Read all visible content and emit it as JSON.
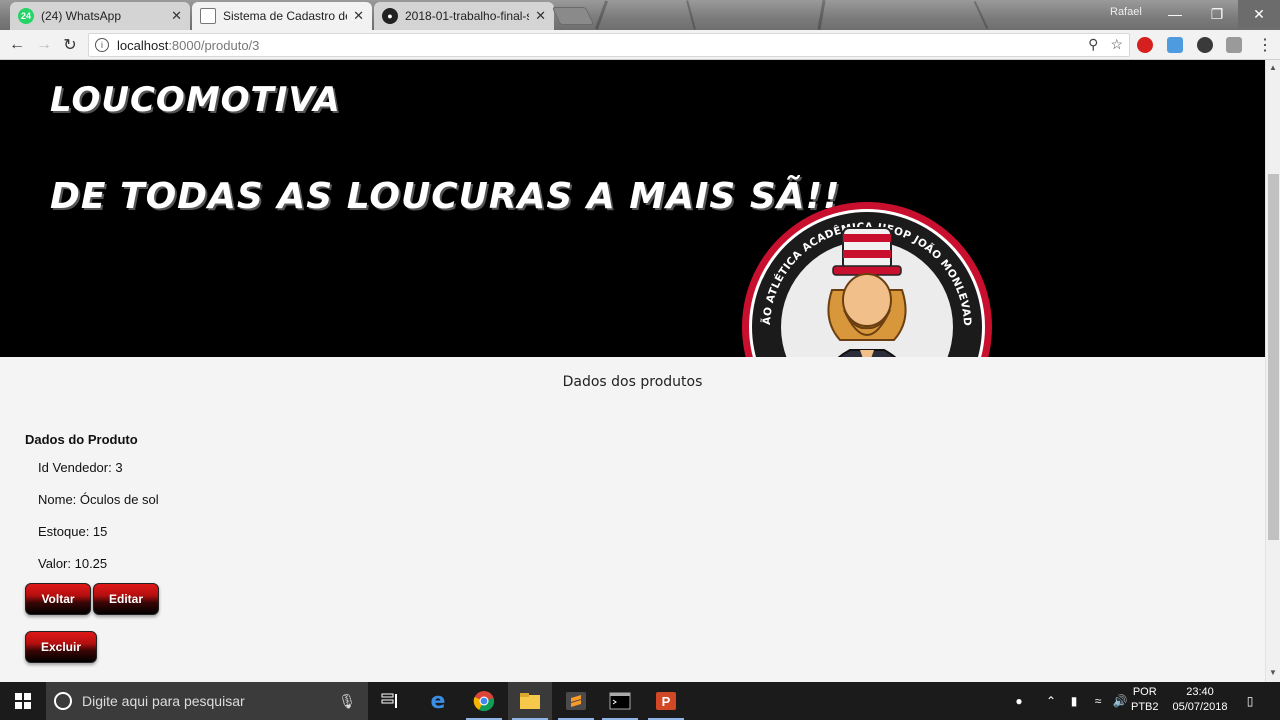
{
  "browser": {
    "tabs": [
      {
        "title": "(24) WhatsApp",
        "badge": "24",
        "favicon_color": "#25d366",
        "icon": "whatsapp-icon",
        "active": false
      },
      {
        "title": "Sistema de Cadastro de",
        "favicon_color": "#ffffff",
        "icon": "document-icon",
        "active": true
      },
      {
        "title": "2018-01-trabalho-final-s",
        "favicon_color": "#222222",
        "icon": "github-icon",
        "active": false
      }
    ],
    "profile_name": "Rafael",
    "url_host": "localhost",
    "url_path": ":8000/produto/3"
  },
  "header": {
    "title": "LOUCOMOTIVA",
    "slogan": "DE TODAS AS LOUCURAS A MAIS SÃ!!",
    "logo_text": "ASSOCIAÇÃO ATLÉTICA ACADÊMICA UFOP JOÃO MONLEVADE - AAAJM",
    "logo_ring_color": "#c8102e"
  },
  "main": {
    "section_title": "Dados dos produtos",
    "card_title": "Dados do Produto",
    "fields": {
      "vendedor": "Id Vendedor: 3",
      "nome": "Nome: Óculos de sol",
      "estoque": "Estoque: 15",
      "valor": "Valor: 10.25"
    },
    "buttons": {
      "voltar": "Voltar",
      "editar": "Editar",
      "excluir": "Excluir"
    },
    "accent_color": "#d01515"
  },
  "taskbar": {
    "search_placeholder": "Digite aqui para pesquisar",
    "language_top": "POR",
    "language_bottom": "PTB2",
    "time": "23:40",
    "date": "05/07/2018"
  }
}
